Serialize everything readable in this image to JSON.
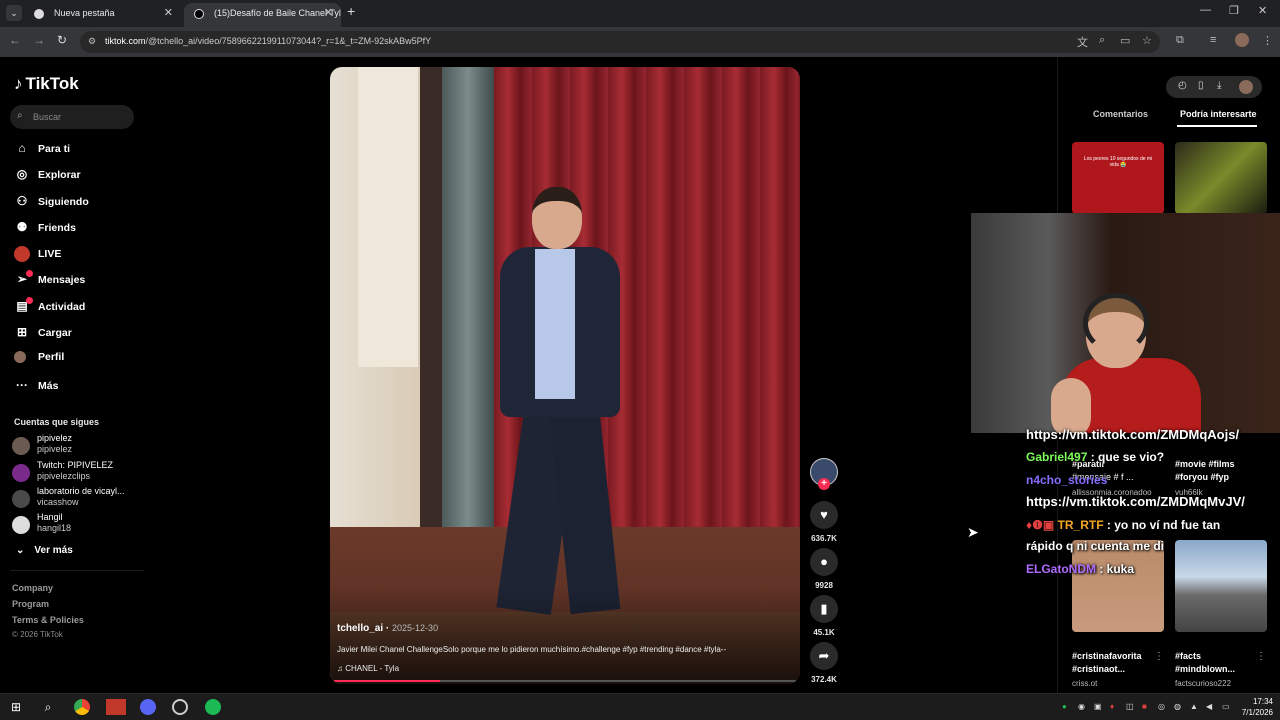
{
  "browser": {
    "tabs": [
      {
        "label": "Nueva pestaña"
      },
      {
        "label": "(15)Desafío de Baile Chanel Tyla"
      }
    ],
    "url_host": "tiktok.com",
    "url_path": "/@tchello_ai/video/7589662219911073044?_r=1&_t=ZM-92skABw5PfY"
  },
  "sidebar": {
    "logo": "TikTok",
    "search_placeholder": "Buscar",
    "menu": [
      {
        "label": "Para ti",
        "icon": "home-icon"
      },
      {
        "label": "Explorar",
        "icon": "compass-icon"
      },
      {
        "label": "Siguiendo",
        "icon": "following-icon"
      },
      {
        "label": "Friends",
        "icon": "friends-icon"
      },
      {
        "label": "LIVE",
        "icon": "live-icon"
      },
      {
        "label": "Mensajes",
        "icon": "messages-icon"
      },
      {
        "label": "Actividad",
        "icon": "activity-icon"
      },
      {
        "label": "Cargar",
        "icon": "upload-icon"
      },
      {
        "label": "Perfil",
        "icon": "profile-avatar"
      },
      {
        "label": "Más",
        "icon": "more-icon"
      }
    ],
    "following_title": "Cuentas que sigues",
    "following": [
      {
        "name": "pipivelez",
        "handle": "pipivelez"
      },
      {
        "name": "Twitch: PIPIVELEZ",
        "handle": "pipivelezclips"
      },
      {
        "name": "laboratorio de vicayl...",
        "handle": "vicasshow"
      },
      {
        "name": "Hangil",
        "handle": "hangil18"
      }
    ],
    "see_more": "Ver más",
    "footer": [
      "Company",
      "Program",
      "Terms & Policies"
    ],
    "copyright": "© 2026 TikTok"
  },
  "video": {
    "username": "tchello_ai",
    "date": "2025-12-30",
    "description": "Javier Milei Chanel ChallengeSolo porque me lo pidieron muchísimo.#challenge #fyp #trending #dance #tyla--",
    "music": "CHANEL - Tyla",
    "progress": 0.23
  },
  "actions": {
    "likes": "636.7K",
    "comments": "9928",
    "saves": "45.1K",
    "shares": "372.4K"
  },
  "right_panel": {
    "tabs": [
      "Comentarios",
      "Podría interesarte"
    ],
    "thumb1_text": "Los peores 10 segundos de mi vida 😭",
    "items": [
      {
        "caption1": "#paratii",
        "caption2": "#mensaje # f ...",
        "author": "allissonmia.coronadoo"
      },
      {
        "caption1": "#movie #films",
        "caption2": "#foryou #fyp",
        "author": "vuh66lk"
      },
      {
        "caption1": "#cristinafavorita",
        "caption2": "#cristinaot...",
        "author": "criss.ot"
      },
      {
        "caption1": "#facts",
        "caption2": "#mindblown...",
        "author": "factscurioso222"
      }
    ]
  },
  "chat": [
    {
      "user": "",
      "text": "https://vm.tiktok.com/ZMDMqAojs/",
      "color": "#ffffff"
    },
    {
      "user": "Gabriel497",
      "text": ": que se vio?",
      "color": "#7cfc5a"
    },
    {
      "user": "n4cho_stories",
      "text": "",
      "color": "#8a6cff"
    },
    {
      "user": "",
      "text": "https://vm.tiktok.com/ZMDMqMvJV/",
      "color": "#ffffff"
    },
    {
      "user": "TR_RTF",
      "text": ": yo no ví nd fue tan",
      "color": "#f5a623"
    },
    {
      "user": "",
      "text": "rápido q ni cuenta me di",
      "color": "#ffffff"
    },
    {
      "user": "ELGatoNDM",
      "text": ": kuka",
      "color": "#b06cff"
    }
  ],
  "taskbar": {
    "time": "17:34",
    "date": "7/1/2026"
  },
  "colors": {
    "accent": "#fe2c55",
    "background": "#000000"
  }
}
